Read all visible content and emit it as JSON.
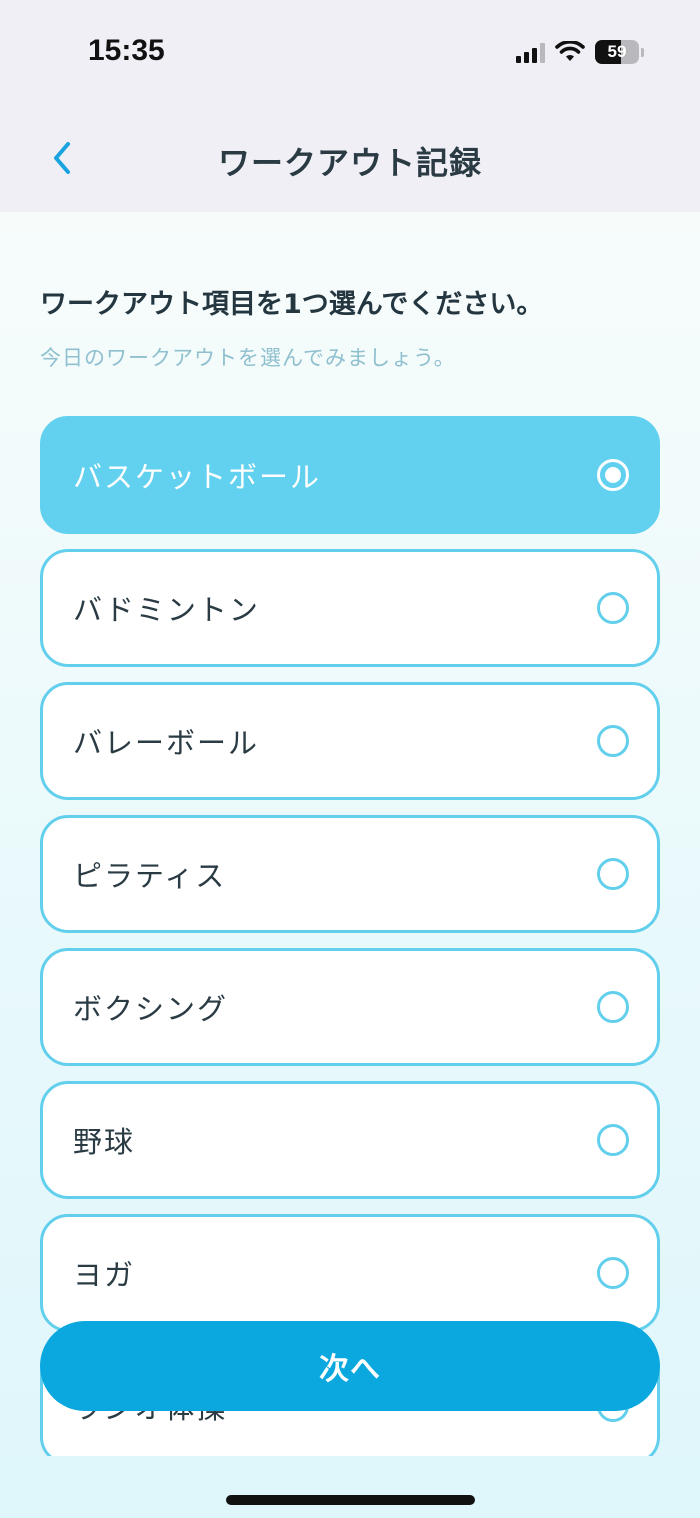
{
  "status_bar": {
    "time": "15:35",
    "battery": "59",
    "battery_level": 0.59,
    "icons": [
      "cellular-signal-icon",
      "wifi-icon",
      "battery-icon"
    ]
  },
  "nav": {
    "back_icon": "chevron-left-icon",
    "title": "ワークアウト記録"
  },
  "prompt": {
    "heading": "ワークアウト項目を1つ選んでください。",
    "subheading": "今日のワークアウトを選んでみましょう。"
  },
  "options": [
    {
      "label": "バスケットボール",
      "selected": true
    },
    {
      "label": "バドミントン",
      "selected": false
    },
    {
      "label": "バレーボール",
      "selected": false
    },
    {
      "label": "ピラティス",
      "selected": false
    },
    {
      "label": "ボクシング",
      "selected": false
    },
    {
      "label": "野球",
      "selected": false
    },
    {
      "label": "ヨガ",
      "selected": false
    },
    {
      "label": "ラジオ体操",
      "selected": false
    }
  ],
  "next_button": {
    "label": "次へ"
  },
  "colors": {
    "accent": "#0ba8df",
    "selected_fill": "#62d0ef",
    "border": "#62cfec",
    "subtext": "#8fc0cf",
    "text": "#2a3b44"
  }
}
